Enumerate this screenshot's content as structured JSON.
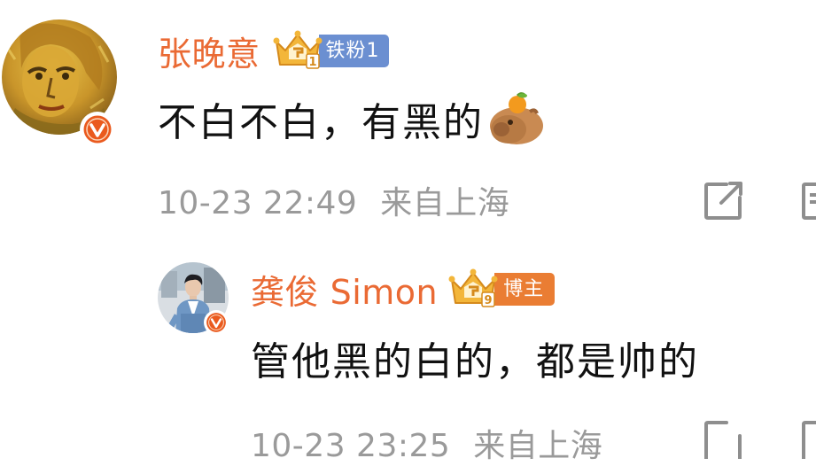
{
  "comments": [
    {
      "username": "张晚意",
      "badge_label": "铁粉1",
      "badge_color": "#6b8fd1",
      "text": "不白不白，有黑的",
      "emoji_icon": "capybara-with-orange-emoji",
      "timestamp": "10-23 22:49",
      "location": "来自上海",
      "verified_color": "#ea5a1e"
    },
    {
      "username": "龚俊 Simon",
      "badge_label": "博主",
      "badge_color": "#ea7d33",
      "text": "管他黑的白的，都是帅的",
      "timestamp": "10-23 23:25",
      "location": "来自上海",
      "verified_color": "#ea5a1e"
    }
  ],
  "colors": {
    "username": "#ea6a34",
    "meta": "#9a9a9a",
    "text": "#111111",
    "crown_gold": "#f3b63a"
  }
}
